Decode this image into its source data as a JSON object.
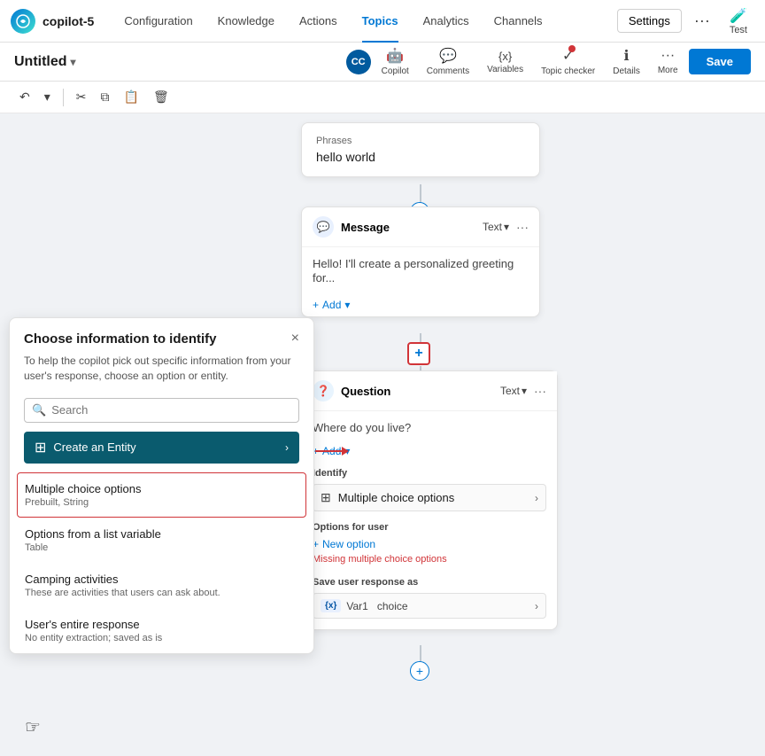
{
  "app": {
    "logo_initials": "★",
    "name": "copilot-5",
    "nav_links": [
      {
        "label": "Configuration",
        "active": false
      },
      {
        "label": "Knowledge",
        "active": false
      },
      {
        "label": "Actions",
        "active": false
      },
      {
        "label": "Topics",
        "active": true
      },
      {
        "label": "Analytics",
        "active": false
      },
      {
        "label": "Channels",
        "active": false
      }
    ],
    "settings_label": "Settings",
    "test_label": "Test"
  },
  "sub_toolbar": {
    "title": "Untitled",
    "avatar": "CC",
    "actions": [
      {
        "label": "Copilot",
        "icon": "🤖"
      },
      {
        "label": "Comments",
        "icon": "💬"
      },
      {
        "label": "Variables",
        "icon": "{x}"
      },
      {
        "label": "Topic checker",
        "icon": "🔴"
      },
      {
        "label": "Details",
        "icon": "ℹ"
      },
      {
        "label": "More",
        "icon": "···"
      }
    ],
    "save_label": "Save"
  },
  "phrases_card": {
    "label": "Phrases",
    "value": "hello world"
  },
  "message_card": {
    "title": "Message",
    "type": "Text",
    "body": "Hello! I'll create a personalized greeting for...",
    "add_label": "Add"
  },
  "question_card": {
    "title": "Question",
    "type": "Text",
    "body": "Where do you live?",
    "add_label": "Add",
    "identify_label": "Identify",
    "identify_value": "Multiple choice options",
    "options_label": "Options for user",
    "new_option_label": "New option",
    "missing_text": "Missing multiple choice options",
    "save_response_label": "Save user response as",
    "var_badge": "{x}",
    "var_name": "Var1",
    "var_type": "choice"
  },
  "choose_panel": {
    "title": "Choose information to identify",
    "close_label": "×",
    "description": "To help the copilot pick out specific information from your user's response, choose an option or entity.",
    "search_placeholder": "Search",
    "create_entity_label": "Create an Entity",
    "items": [
      {
        "title": "Multiple choice options",
        "subtitle": "Prebuilt, String",
        "selected": true
      },
      {
        "title": "Options from a list variable",
        "subtitle": "Table",
        "selected": false
      },
      {
        "title": "Camping activities",
        "subtitle": "These are activities that users can ask about.",
        "selected": false
      },
      {
        "title": "User's entire response",
        "subtitle": "No entity extraction; saved as is",
        "selected": false
      }
    ]
  }
}
